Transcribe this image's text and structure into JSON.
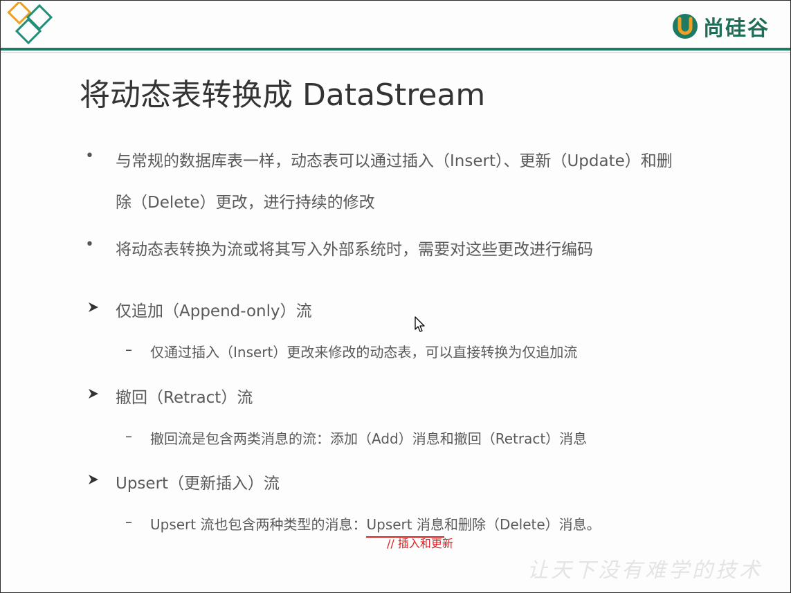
{
  "logo": {
    "text": "尚硅谷",
    "mark_letter": "U",
    "brand_color": "#1f7a63",
    "accent_color": "#f0a020"
  },
  "slide": {
    "title": "将动态表转换成 DataStream",
    "bullets": [
      {
        "line1": "与常规的数据库表一样，动态表可以通过插入（Insert）、更新（Update）和删",
        "line2": "除（Delete）更改，进行持续的修改"
      },
      {
        "line1": "将动态表转换为流或将其写入外部系统时，需要对这些更改进行编码"
      }
    ],
    "sections": [
      {
        "heading": "仅追加（Append-only）流",
        "detail": "仅通过插入（Insert）更改来修改的动态表，可以直接转换为仅追加流"
      },
      {
        "heading": "撤回（Retract）流",
        "detail": "撤回流是包含两类消息的流：添加（Add）消息和撤回（Retract）消息"
      },
      {
        "heading": "Upsert（更新插入）流",
        "detail_prefix": "Upsert 流也包含两种类型的消息：",
        "detail_highlight": "Upsert 消息",
        "detail_suffix": "和删除（Delete）消息。"
      }
    ],
    "annotation": "// 插入和更新",
    "watermark": "让天下没有难学的技术",
    "bullet_symbol": "•",
    "dash_symbol": "–"
  }
}
